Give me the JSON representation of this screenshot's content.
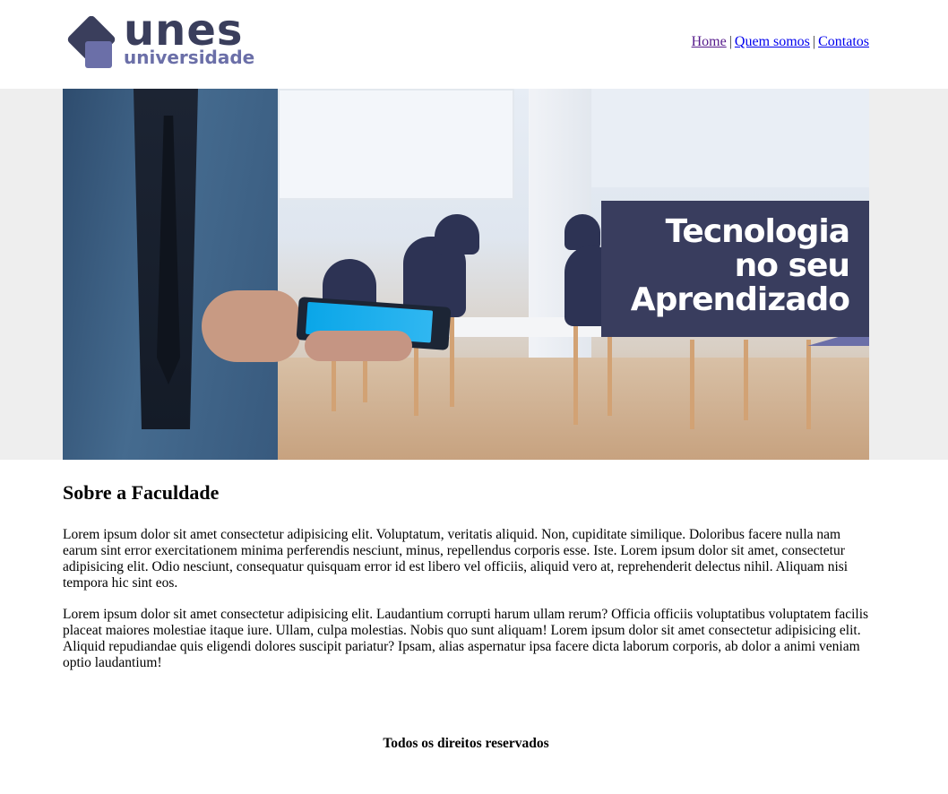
{
  "logo": {
    "main": "unes",
    "sub": "universidade",
    "brand_dark": "#3a3e5c",
    "brand_light": "#6b6fa8"
  },
  "nav": {
    "items": [
      {
        "label": "Home"
      },
      {
        "label": "Quem somos"
      },
      {
        "label": "Contatos"
      }
    ],
    "separator": "|"
  },
  "banner": {
    "tagline": [
      "Tecnologia",
      "no seu",
      "Aprendizado"
    ],
    "tag_color": "#393d5e"
  },
  "about": {
    "title": "Sobre a Faculdade",
    "paragraphs": [
      "Lorem ipsum dolor sit amet consectetur adipisicing elit. Voluptatum, veritatis aliquid. Non, cupiditate similique. Doloribus facere nulla nam earum sint error exercitationem minima perferendis nesciunt, minus, repellendus corporis esse. Iste. Lorem ipsum dolor sit amet, consectetur adipisicing elit. Odio nesciunt, consequatur quisquam error id est libero vel officiis, aliquid vero at, reprehenderit delectus nihil. Aliquam nisi tempora hic sint eos.",
      "Lorem ipsum dolor sit amet consectetur adipisicing elit. Laudantium corrupti harum ullam rerum? Officia officiis voluptatibus voluptatem facilis placeat maiores molestiae itaque iure. Ullam, culpa molestias. Nobis quo sunt aliquam! Lorem ipsum dolor sit amet consectetur adipisicing elit. Aliquid repudiandae quis eligendi dolores suscipit pariatur? Ipsam, alias aspernatur ipsa facere dicta laborum corporis, ab dolor a animi veniam optio laudantium!"
    ]
  },
  "footer": {
    "text": "Todos os direitos reservados"
  }
}
